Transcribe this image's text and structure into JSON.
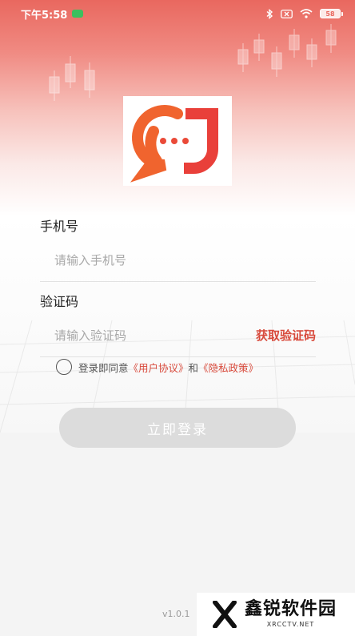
{
  "status_bar": {
    "time": "下午5:58",
    "battery": "58"
  },
  "icons": {
    "notification": "green-pill-icon",
    "bluetooth": "bluetooth-icon",
    "sim": "sim-off-icon",
    "wifi": "wifi-icon",
    "battery": "battery-icon",
    "logo": "chat-bubble-j-logo-icon",
    "watermark_logo": "x-logo-icon"
  },
  "colors": {
    "brand_red": "#d84a3c",
    "logo_orange": "#f0642e",
    "button_disabled": "#dcdcdc"
  },
  "form": {
    "phone_label": "手机号",
    "phone_placeholder": "请输入手机号",
    "code_label": "验证码",
    "code_placeholder": "请输入验证码",
    "get_code": "获取验证码"
  },
  "agreement": {
    "prefix": "登录即同意",
    "user_agreement": "《用户协议》",
    "and": "和",
    "privacy_policy": "《隐私政策》"
  },
  "login_button": "立即登录",
  "version": "v1.0.1",
  "watermark": {
    "title": "鑫锐软件园",
    "sub": "XRCCTV.NET"
  }
}
